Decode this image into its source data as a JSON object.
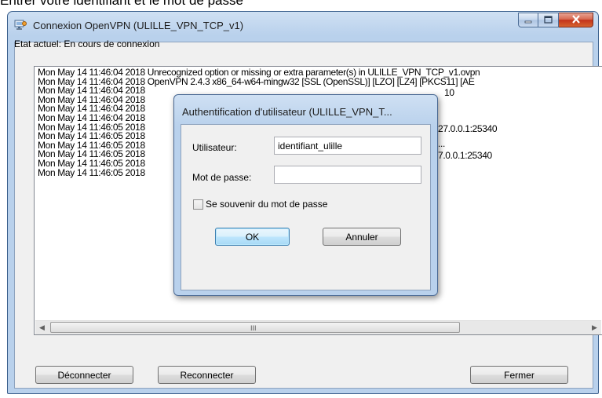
{
  "caption": "Entrer votre identifiant et le mot de passe",
  "window": {
    "title": "Connexion OpenVPN (ULILLE_VPN_TCP_v1)",
    "app_icon": "openvpn-monitor-icon",
    "minimize_icon": "minimize-icon",
    "maximize_icon": "maximize-icon",
    "close_icon": "close-icon"
  },
  "status": {
    "label": "Etat actuel: En cours de connexion"
  },
  "log": {
    "lines": [
      "Mon May 14 11:46:04 2018 Unrecognized option or missing or extra parameter(s) in ULILLE_VPN_TCP_v1.ovpn",
      "Mon May 14 11:46:04 2018 OpenVPN 2.4.3 x86_64-w64-mingw32 [SSL (OpenSSL)] [LZO] [LZ4] [PKCS11] [AE",
      "Mon May 14 11:46:04 2018",
      "Mon May 14 11:46:04 2018",
      "Mon May 14 11:46:04 2018",
      "Mon May 14 11:46:04 2018",
      "Mon May 14 11:46:05 2018",
      "Mon May 14 11:46:05 2018",
      "Mon May 14 11:46:05 2018",
      "Mon May 14 11:46:05 2018",
      "Mon May 14 11:46:05 2018",
      "Mon May 14 11:46:05 2018"
    ],
    "fragments": [
      "10",
      "27.0.0.1:25340",
      "...",
      "7.0.0.1:25340"
    ],
    "scroll_left_icon": "scroll-left-arrow-icon",
    "scroll_right_icon": "scroll-right-arrow-icon",
    "scroll_grip": "III"
  },
  "buttons": {
    "disconnect": "Déconnecter",
    "reconnect": "Reconnecter",
    "close": "Fermer"
  },
  "dialog": {
    "title": "Authentification d'utilisateur (ULILLE_VPN_T...",
    "username_label": "Utilisateur:",
    "username_value": "identifiant_ulille",
    "password_label": "Mot de passe:",
    "password_value": "",
    "remember_label": "Se souvenir du mot de passe",
    "remember_checked": false,
    "ok_label": "OK",
    "cancel_label": "Annuler"
  }
}
